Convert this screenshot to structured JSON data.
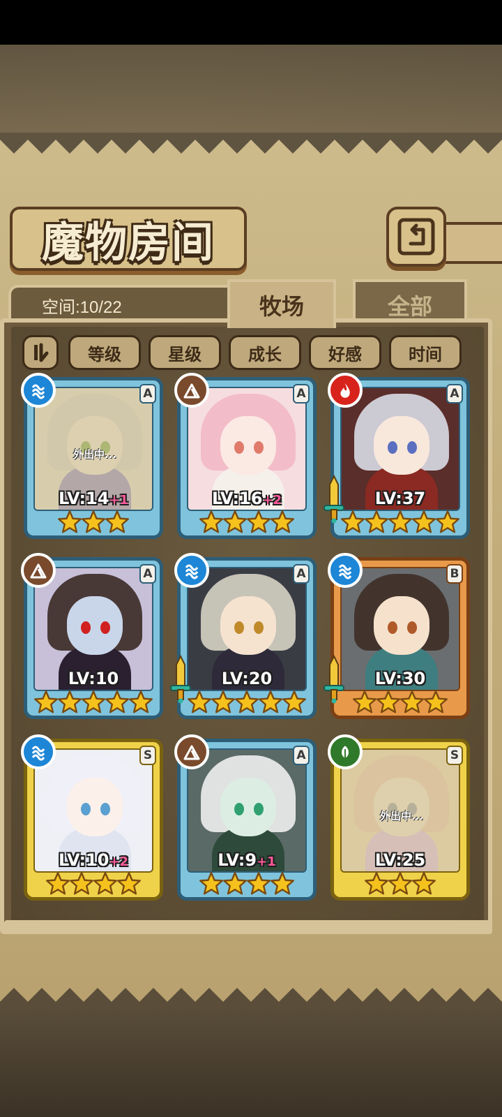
{
  "header": {
    "title": "魔物房间"
  },
  "space": {
    "label": "空间:10/22"
  },
  "tabs": [
    {
      "label": "牧场",
      "active": true
    },
    {
      "label": "全部",
      "active": false
    }
  ],
  "sort": {
    "toggle_icon": "sort-toggle-icon",
    "buttons": [
      "等级",
      "星级",
      "成长",
      "好感",
      "时间"
    ]
  },
  "colors": {
    "frame_blue": "#5fa9c8",
    "frame_orange": "#e08a3a",
    "frame_gold": "#e7c33a",
    "star": "#f5c21d",
    "plus_pink": "#ff5a9a"
  },
  "monsters": [
    {
      "element": "water",
      "rank": "A",
      "level": "LV:14",
      "plus": "+1",
      "stars": 3,
      "status": "外出中...",
      "frame": "blue",
      "sword": false
    },
    {
      "element": "earth",
      "rank": "A",
      "level": "LV:16",
      "plus": "+2",
      "stars": 4,
      "status": "",
      "frame": "blue",
      "sword": false
    },
    {
      "element": "fire",
      "rank": "A",
      "level": "LV:37",
      "plus": "",
      "stars": 5,
      "status": "",
      "frame": "blue",
      "sword": true
    },
    {
      "element": "earth",
      "rank": "A",
      "level": "LV:10",
      "plus": "",
      "stars": 5,
      "status": "",
      "frame": "blue",
      "sword": false
    },
    {
      "element": "water",
      "rank": "A",
      "level": "LV:20",
      "plus": "",
      "stars": 5,
      "status": "",
      "frame": "blue",
      "sword": true
    },
    {
      "element": "water",
      "rank": "B",
      "level": "LV:30",
      "plus": "",
      "stars": 4,
      "status": "",
      "frame": "orange",
      "sword": true
    },
    {
      "element": "water",
      "rank": "S",
      "level": "LV:10",
      "plus": "+2",
      "stars": 4,
      "status": "",
      "frame": "gold",
      "sword": false
    },
    {
      "element": "earth",
      "rank": "A",
      "level": "LV:9",
      "plus": "+1",
      "stars": 4,
      "status": "",
      "frame": "blue",
      "sword": false
    },
    {
      "element": "wood",
      "rank": "S",
      "level": "LV:25",
      "plus": "",
      "stars": 3,
      "status": "外出中...",
      "frame": "gold",
      "sword": false
    }
  ]
}
